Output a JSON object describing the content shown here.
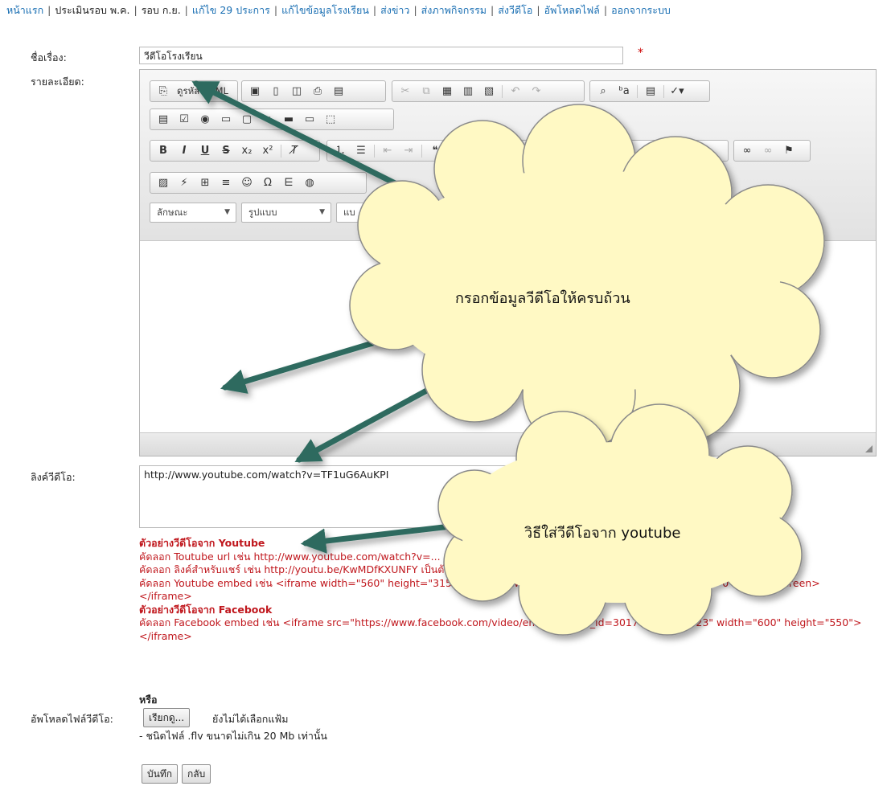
{
  "nav": {
    "items": [
      "หน้าแรก",
      "ประเมินรอบ พ.ค.",
      "รอบ ก.ย.",
      "แก้ไข 29 ประการ",
      "แก้ไขข้อมูลโรงเรียน",
      "ส่งข่าว",
      "ส่งภาพกิจกรรม",
      "ส่งวีดีโอ",
      "อัพโหลดไฟล์",
      "ออกจากระบบ"
    ]
  },
  "form": {
    "title_label": "ชื่อเรื่อง:",
    "title_value": "วีดีโอโรงเรียน",
    "required_mark": "*",
    "detail_label": "รายละเอียด:",
    "video_link_label": "ลิงค์วีดีโอ:",
    "video_link_value": "http://www.youtube.com/watch?v=TF1uG6AuKPI",
    "upload_label": "อัพโหลดไฟล์วีดีโอ:",
    "browse_button": "เรียกดู...",
    "no_file_text": "ยังไม่ได้เลือกแฟ้ม",
    "file_note": "- ชนิดไฟล์ .flv ขนาดไม่เกิน 20 Mb เท่านั้น",
    "or_text": "หรือ",
    "save_button": "บันทึก",
    "back_button": "กลับ"
  },
  "editor": {
    "source_label": "ดูรหัส HTML",
    "combos": [
      "ลักษณะ",
      "รูปแบบ",
      "แบ"
    ]
  },
  "help": {
    "youtube_heading": "ตัวอย่างวีดีโอจาก Youtube",
    "youtube_line1": "คัดลอก Toutube url เช่น http://www.youtube.com/watch?v=...",
    "youtube_line2": "คัดลอก ลิงค์สำหรับแชร์ เช่น http://youtu.be/KwMDfKXUNFY เป็นต้น",
    "youtube_line3": "คัดลอก Youtube embed เช่น <iframe width=\"560\" height=\"315\" src=\"//www.youtube.com/embed/...\" frameborder=\"0\" allowfullscreen>",
    "youtube_line4": "</iframe>",
    "facebook_heading": "ตัวอย่างวีดีโอจาก Facebook",
    "facebook_line1": "คัดลอก Facebook embed เช่น <iframe src=\"https://www.facebook.com/video/embed?video_id=301767319878723\" width=\"600\" height=\"550\"></iframe>"
  },
  "annotations": {
    "cloud1_text": "กรอกข้อมูลวีดีโอให้ครบถ้วน",
    "cloud2_text": "วิธีใส่วีดีโอจาก    youtube"
  },
  "colors": {
    "link": "#1a6fb3",
    "help_text": "#c0171d",
    "cloud_fill": "#fff9c4",
    "arrow": "#2f6b5e"
  }
}
